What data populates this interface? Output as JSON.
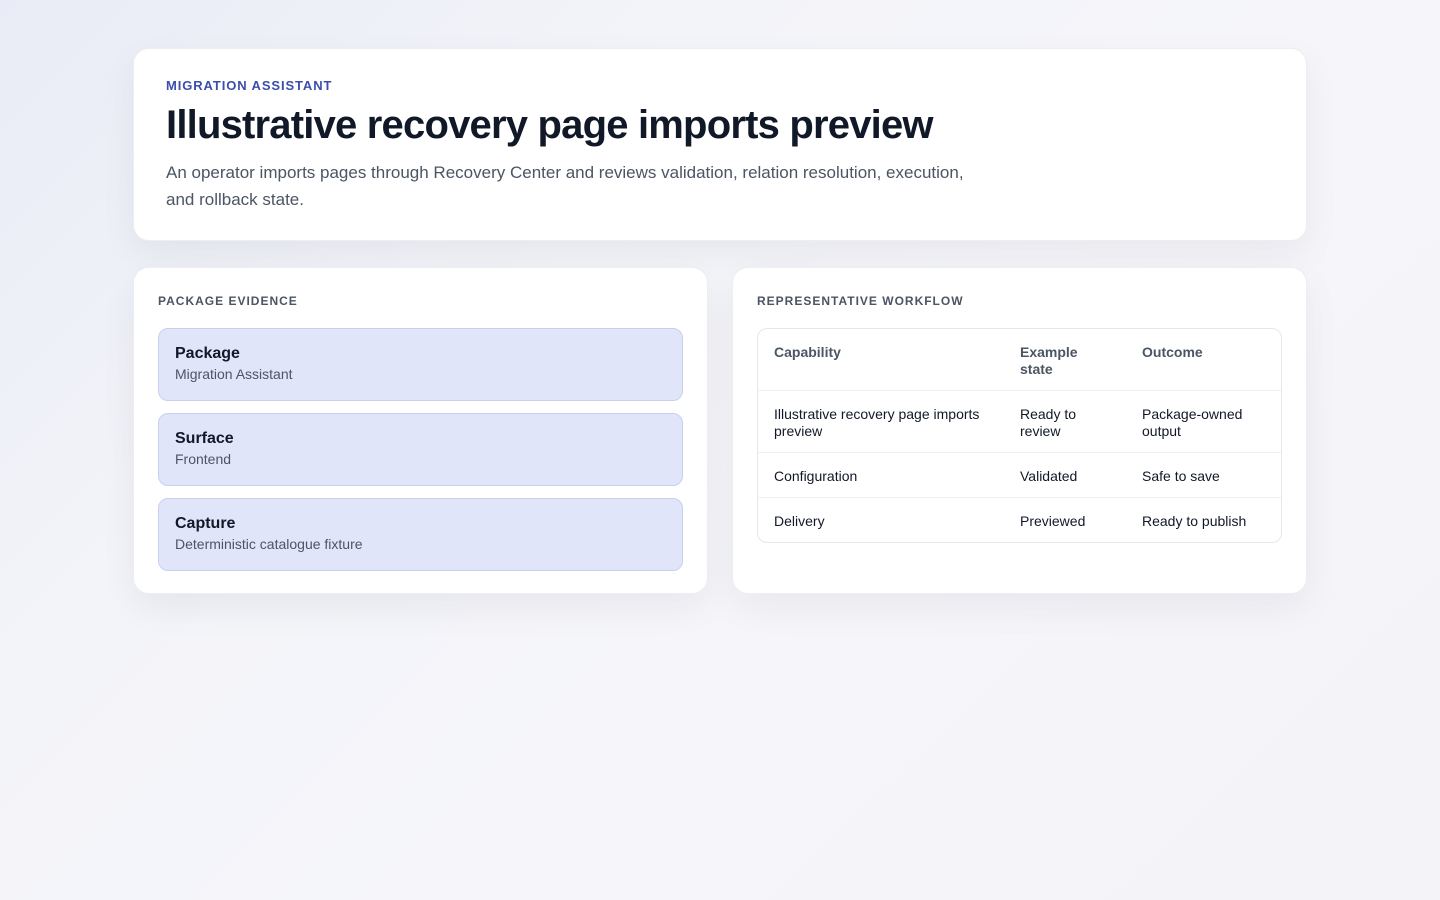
{
  "hero": {
    "eyebrow": "MIGRATION ASSISTANT",
    "title": "Illustrative recovery page imports preview",
    "description": "An operator imports pages through Recovery Center and reviews validation, relation resolution, execution, and rollback state."
  },
  "evidence": {
    "heading": "PACKAGE EVIDENCE",
    "items": [
      {
        "label": "Package",
        "value": "Migration Assistant"
      },
      {
        "label": "Surface",
        "value": "Frontend"
      },
      {
        "label": "Capture",
        "value": "Deterministic catalogue fixture"
      }
    ]
  },
  "workflow": {
    "heading": "REPRESENTATIVE WORKFLOW",
    "columns": [
      "Capability",
      "Example state",
      "Outcome"
    ],
    "rows": [
      [
        "Illustrative recovery page imports preview",
        "Ready to review",
        "Package-owned output"
      ],
      [
        "Configuration",
        "Validated",
        "Safe to save"
      ],
      [
        "Delivery",
        "Previewed",
        "Ready to publish"
      ]
    ]
  }
}
